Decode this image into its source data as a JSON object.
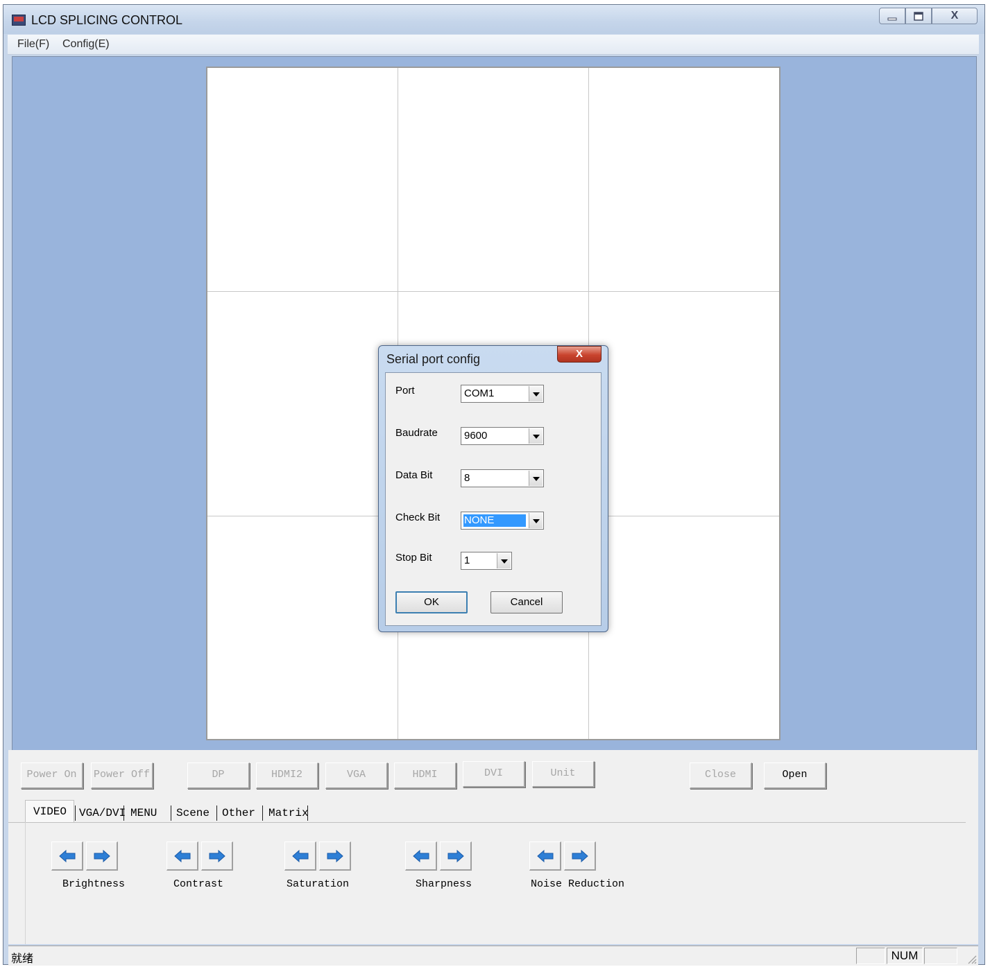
{
  "window": {
    "title": "LCD SPLICING CONTROL",
    "caption": {
      "close": "X"
    }
  },
  "menu": {
    "items": [
      "File(F)",
      "Config(E)"
    ]
  },
  "dialog": {
    "title": "Serial port config",
    "close": "X",
    "fields": [
      {
        "label": "Port",
        "value": "COM1"
      },
      {
        "label": "Baudrate",
        "value": "9600"
      },
      {
        "label": "Data Bit",
        "value": "8"
      },
      {
        "label": "Check Bit",
        "value": "NONE",
        "highlighted": true
      },
      {
        "label": "Stop Bit",
        "value": "1"
      }
    ],
    "ok": "OK",
    "cancel": "Cancel"
  },
  "controls": {
    "buttons": [
      {
        "label": "Power On",
        "enabled": false
      },
      {
        "label": "Power Off",
        "enabled": false
      },
      {
        "label": "DP",
        "enabled": false
      },
      {
        "label": "HDMI2",
        "enabled": false
      },
      {
        "label": "VGA",
        "enabled": false
      },
      {
        "label": "HDMI",
        "enabled": false
      },
      {
        "label": "DVI",
        "enabled": false
      },
      {
        "label": "Unit",
        "enabled": false
      },
      {
        "label": "Close",
        "enabled": false
      },
      {
        "label": "Open",
        "enabled": true
      }
    ],
    "tabs": [
      "VIDEO",
      "VGA/DVI",
      "MENU",
      "Scene",
      "Other",
      "Matrix"
    ],
    "active_tab": "VIDEO",
    "adjustments": [
      "Brightness",
      "Contrast",
      "Saturation",
      "Sharpness",
      "Noise Reduction"
    ]
  },
  "status": {
    "text": "就绪",
    "num": "NUM"
  },
  "colors": {
    "arrow": "#2e7fd6",
    "client_bg": "#99b4dc",
    "selection": "#3399ff"
  }
}
